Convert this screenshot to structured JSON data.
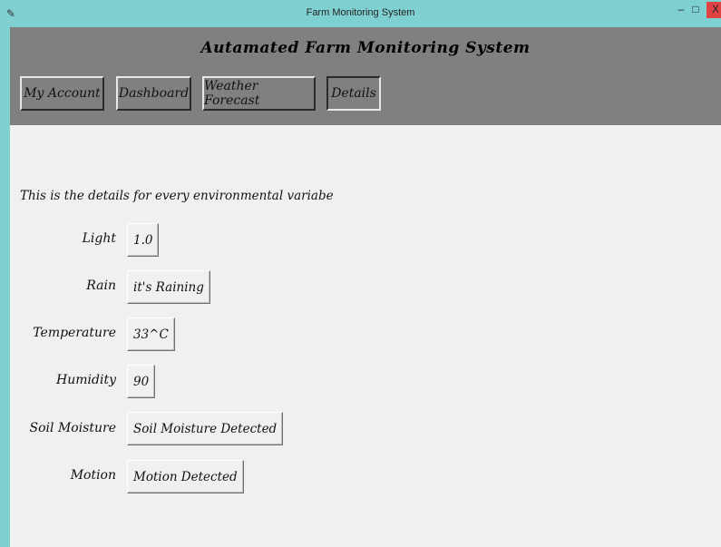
{
  "window": {
    "title": "Farm Monitoring System",
    "controls": {
      "minimize": "–",
      "maximize": "□",
      "close": "X"
    }
  },
  "header": {
    "title": "Autamated Farm Monitoring System",
    "nav": [
      {
        "label": "My Account"
      },
      {
        "label": "Dashboard"
      },
      {
        "label": "Weather Forecast"
      },
      {
        "label": "Details",
        "active": true
      }
    ]
  },
  "details": {
    "intro": "This is the details for every environmental variabe",
    "rows": [
      {
        "label": "Light",
        "value": "1.0"
      },
      {
        "label": "Rain",
        "value": "it's Raining"
      },
      {
        "label": "Temperature",
        "value": "33^C"
      },
      {
        "label": "Humidity",
        "value": "90"
      },
      {
        "label": "Soil Moisture",
        "value": "Soil Moisture Detected"
      },
      {
        "label": "Motion",
        "value": "Motion Detected"
      }
    ]
  },
  "colors": {
    "titlebar": "#7fd1d1",
    "header": "#808080",
    "content": "#f0f0f0",
    "close": "#e04343"
  }
}
